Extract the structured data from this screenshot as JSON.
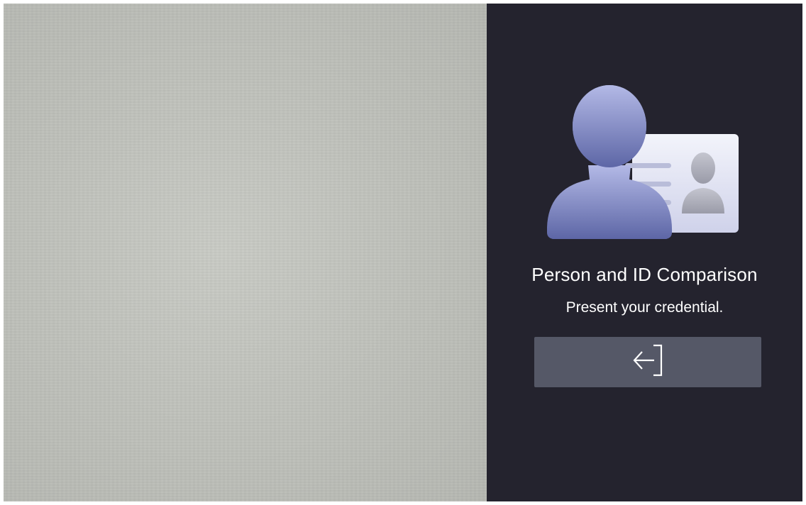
{
  "camera_view": {
    "background_color": "#c3c5bf"
  },
  "panel": {
    "background_color": "#24232e",
    "illustration_icon": "person-and-id-card-icon",
    "title": "Person and ID Comparison",
    "subtitle": "Present your credential.",
    "exit_button": {
      "icon": "exit-arrow-icon",
      "background_color": "#555867"
    }
  }
}
